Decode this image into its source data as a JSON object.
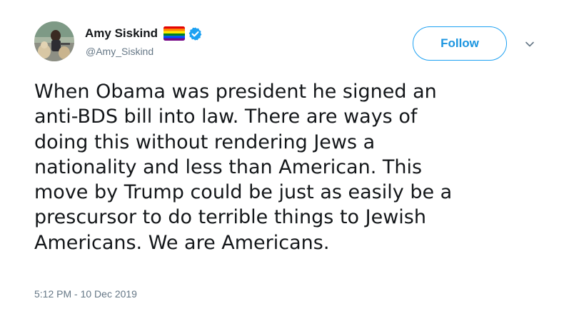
{
  "tweet": {
    "author": {
      "display_name": "Amy Siskind",
      "handle": "@Amy_Siskind",
      "avatar_icon": "user-avatar-photo",
      "badges": [
        "rainbow-flag-icon",
        "verified-badge-icon"
      ]
    },
    "follow_label": "Follow",
    "menu_icon": "chevron-down-icon",
    "text": "When Obama was president he signed an\nanti-BDS bill into law.  There are ways of\ndoing this without rendering Jews a\nnationality and less than American.  This\nmove by Trump could be just as easily be a\nprescursor to do terrible things to Jewish\nAmericans. We are Americans.",
    "timestamp": "5:12 PM - 10 Dec 2019"
  },
  "colors": {
    "accent": "#1da1f2",
    "text": "#14171a",
    "muted": "#657786",
    "verified": "#1da1f2"
  }
}
